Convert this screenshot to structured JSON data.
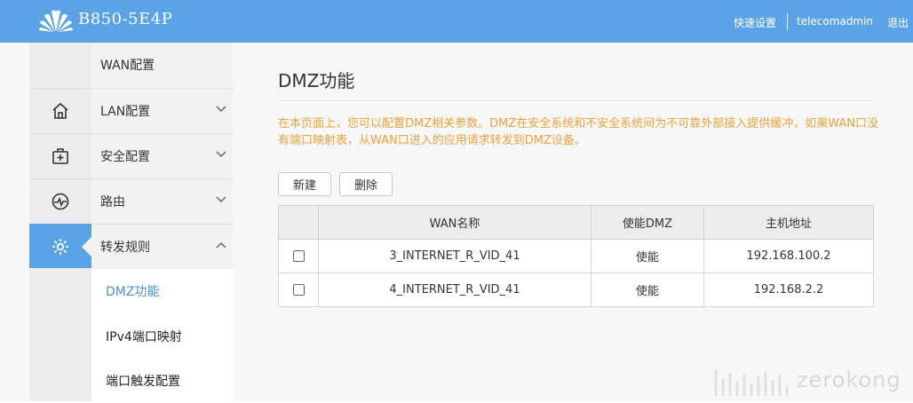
{
  "header": {
    "model": "B850-5E4P",
    "quick_setup": "快速设置",
    "user": "telecomadmin",
    "logout": "退出",
    "bg_color": "#5aa3e6"
  },
  "rail": [
    {
      "icon": "home-icon"
    },
    {
      "icon": "firstaid-icon"
    },
    {
      "icon": "route-icon"
    },
    {
      "icon": "gear-icon",
      "active": true
    }
  ],
  "menu": {
    "items": [
      {
        "label": "WAN配置"
      },
      {
        "label": "LAN配置",
        "chevron": "down"
      },
      {
        "label": "安全配置",
        "chevron": "down"
      },
      {
        "label": "路由",
        "chevron": "down"
      },
      {
        "label": "转发规则",
        "chevron": "up",
        "expanded": true
      }
    ],
    "subitems": [
      {
        "label": "DMZ功能",
        "active": true
      },
      {
        "label": "IPv4端口映射"
      },
      {
        "label": "端口触发配置"
      }
    ]
  },
  "main": {
    "title": "DMZ功能",
    "description": "在本页面上，您可以配置DMZ相关参数。DMZ在安全系统和不安全系统间为不可靠外部接入提供缓冲，如果WAN口没有端口映射表，从WAN口进入的应用请求转发到DMZ设备。",
    "buttons": {
      "new": "新建",
      "delete": "删除"
    },
    "table": {
      "headers": [
        "",
        "WAN名称",
        "使能DMZ",
        "主机地址"
      ],
      "rows": [
        {
          "wan": "3_INTERNET_R_VID_41",
          "enable": "使能",
          "host": "192.168.100.2"
        },
        {
          "wan": "4_INTERNET_R_VID_41",
          "enable": "使能",
          "host": "192.168.2.2"
        }
      ]
    }
  },
  "watermark": "zerokong"
}
